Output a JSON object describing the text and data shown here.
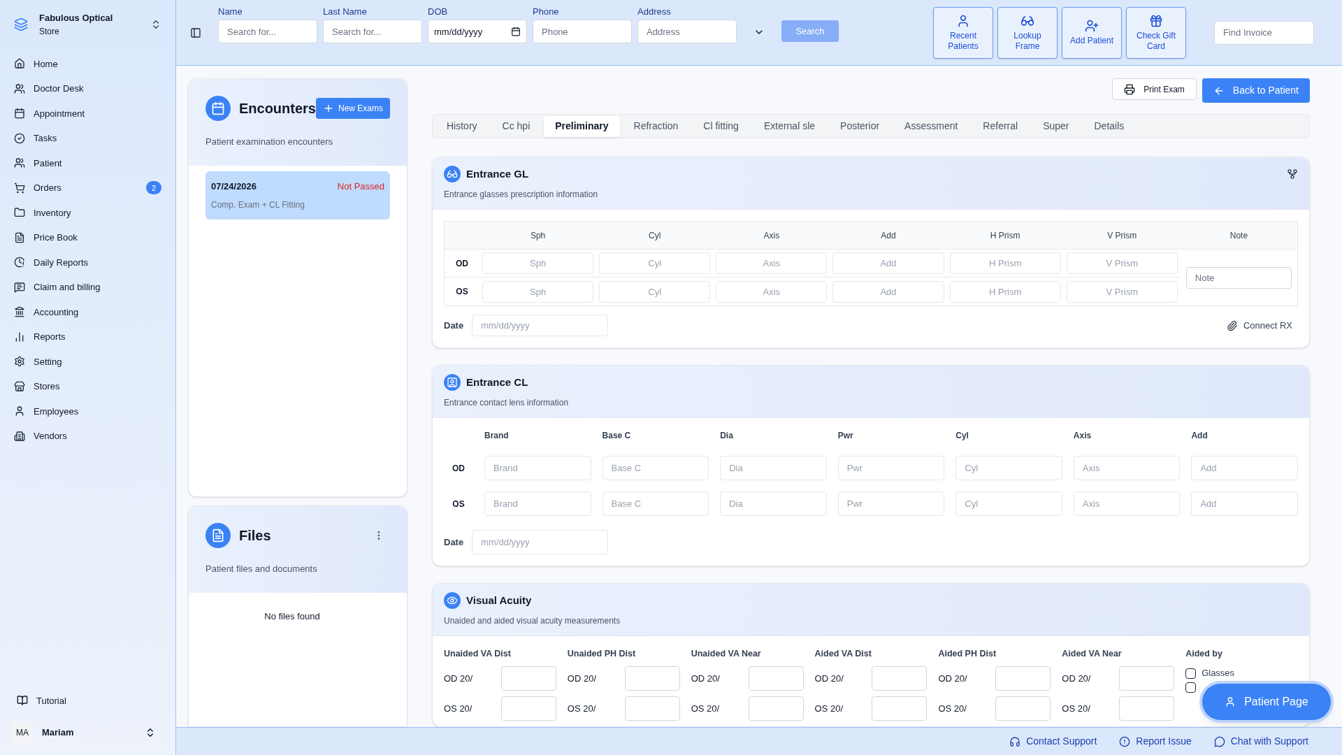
{
  "store": {
    "name": "Fabulous Optical",
    "subtitle": "Store"
  },
  "nav": [
    {
      "label": "Home"
    },
    {
      "label": "Doctor Desk"
    },
    {
      "label": "Appointment"
    },
    {
      "label": "Tasks"
    },
    {
      "label": "Patient"
    },
    {
      "label": "Orders",
      "badge": "2"
    },
    {
      "label": "Inventory"
    },
    {
      "label": "Price Book"
    },
    {
      "label": "Daily Reports"
    },
    {
      "label": "Claim and billing"
    },
    {
      "label": "Accounting"
    },
    {
      "label": "Reports"
    },
    {
      "label": "Setting"
    },
    {
      "label": "Stores"
    },
    {
      "label": "Employees"
    },
    {
      "label": "Vendors"
    }
  ],
  "tutorial": "Tutorial",
  "user": {
    "initials": "MA",
    "name": "Mariam"
  },
  "search_fields": [
    {
      "label": "Name",
      "placeholder": "Search for...",
      "kind": "text"
    },
    {
      "label": "Last Name",
      "placeholder": "Search for...",
      "kind": "text"
    },
    {
      "label": "DOB",
      "value": "mm/dd/yyyy",
      "kind": "date"
    },
    {
      "label": "Phone",
      "placeholder": "Phone",
      "kind": "text"
    },
    {
      "label": "Address",
      "placeholder": "Address",
      "kind": "text"
    }
  ],
  "search_button": "Search",
  "quick_actions": [
    {
      "label": "Recent Patients"
    },
    {
      "label": "Lookup Frame"
    },
    {
      "label": "Add Patient"
    },
    {
      "label": "Check Gift Card"
    }
  ],
  "find_invoice": {
    "placeholder": "Find Invoice"
  },
  "encounters": {
    "title": "Encounters",
    "new_button": "New Exams",
    "subtitle": "Patient examination encounters",
    "items": [
      {
        "date": "07/24/2026",
        "status": "Not Passed",
        "description": "Comp. Exam + CL Fitting",
        "selected": true
      }
    ]
  },
  "files": {
    "title": "Files",
    "subtitle": "Patient files and documents",
    "empty": "No files found"
  },
  "print_button": "Print Exam",
  "back_button": "Back to Patient",
  "tabs": [
    {
      "label": "History",
      "selected": false
    },
    {
      "label": "Cc hpi",
      "selected": false
    },
    {
      "label": "Preliminary",
      "selected": true
    },
    {
      "label": "Refraction",
      "selected": false
    },
    {
      "label": "Cl fitting",
      "selected": false
    },
    {
      "label": "External sle",
      "selected": false
    },
    {
      "label": "Posterior",
      "selected": false
    },
    {
      "label": "Assessment",
      "selected": false
    },
    {
      "label": "Referral",
      "selected": false
    },
    {
      "label": "Super",
      "selected": false
    },
    {
      "label": "Details",
      "selected": false
    }
  ],
  "entrance_gl": {
    "title": "Entrance GL",
    "subtitle": "Entrance glasses prescription information",
    "columns": [
      "Sph",
      "Cyl",
      "Axis",
      "Add",
      "H Prism",
      "V Prism",
      "Note"
    ],
    "rows": [
      {
        "eye": "OD",
        "placeholders": [
          "Sph",
          "Cyl",
          "Axis",
          "Add",
          "H Prism",
          "V Prism"
        ]
      },
      {
        "eye": "OS",
        "placeholders": [
          "Sph",
          "Cyl",
          "Axis",
          "Add",
          "H Prism",
          "V Prism"
        ]
      }
    ],
    "note_placeholder": "Note",
    "date_label": "Date",
    "date_placeholder": "mm/dd/yyyy",
    "connect": "Connect RX"
  },
  "entrance_cl": {
    "title": "Entrance CL",
    "subtitle": "Entrance contact lens information",
    "columns": [
      "Brand",
      "Base C",
      "Dia",
      "Pwr",
      "Cyl",
      "Axis",
      "Add"
    ],
    "rows": [
      {
        "eye": "OD",
        "placeholders": [
          "Brand",
          "Base C",
          "Dia",
          "Pwr",
          "Cyl",
          "Axis",
          "Add"
        ]
      },
      {
        "eye": "OS",
        "placeholders": [
          "Brand",
          "Base C",
          "Dia",
          "Pwr",
          "Cyl",
          "Axis",
          "Add"
        ]
      }
    ],
    "date_label": "Date",
    "date_placeholder": "mm/dd/yyyy"
  },
  "visual_acuity": {
    "title": "Visual Acuity",
    "subtitle": "Unaided and aided visual acuity measurements",
    "columns": [
      {
        "title": "Unaided VA Dist",
        "rows": [
          "OD 20/",
          "OS 20/"
        ]
      },
      {
        "title": "Unaided PH Dist",
        "rows": [
          "OD 20/",
          "OS 20/"
        ]
      },
      {
        "title": "Unaided VA Near",
        "rows": [
          "OD 20/",
          "OS 20/"
        ]
      },
      {
        "title": "Aided VA Dist",
        "rows": [
          "OD 20/",
          "OS 20/"
        ]
      },
      {
        "title": "Aided PH Dist",
        "rows": [
          "OD 20/",
          "OS 20/"
        ]
      },
      {
        "title": "Aided VA Near",
        "rows": [
          "OD 20/",
          "OS 20/"
        ]
      }
    ],
    "aided_by": {
      "title": "Aided by",
      "options": [
        {
          "label": "Glasses",
          "checked": false
        },
        {
          "checked": false
        }
      ]
    }
  },
  "patient_page_button": "Patient Page",
  "footer_links": [
    {
      "label": "Contact Support"
    },
    {
      "label": "Report Issue"
    },
    {
      "label": "Chat with Support"
    }
  ]
}
